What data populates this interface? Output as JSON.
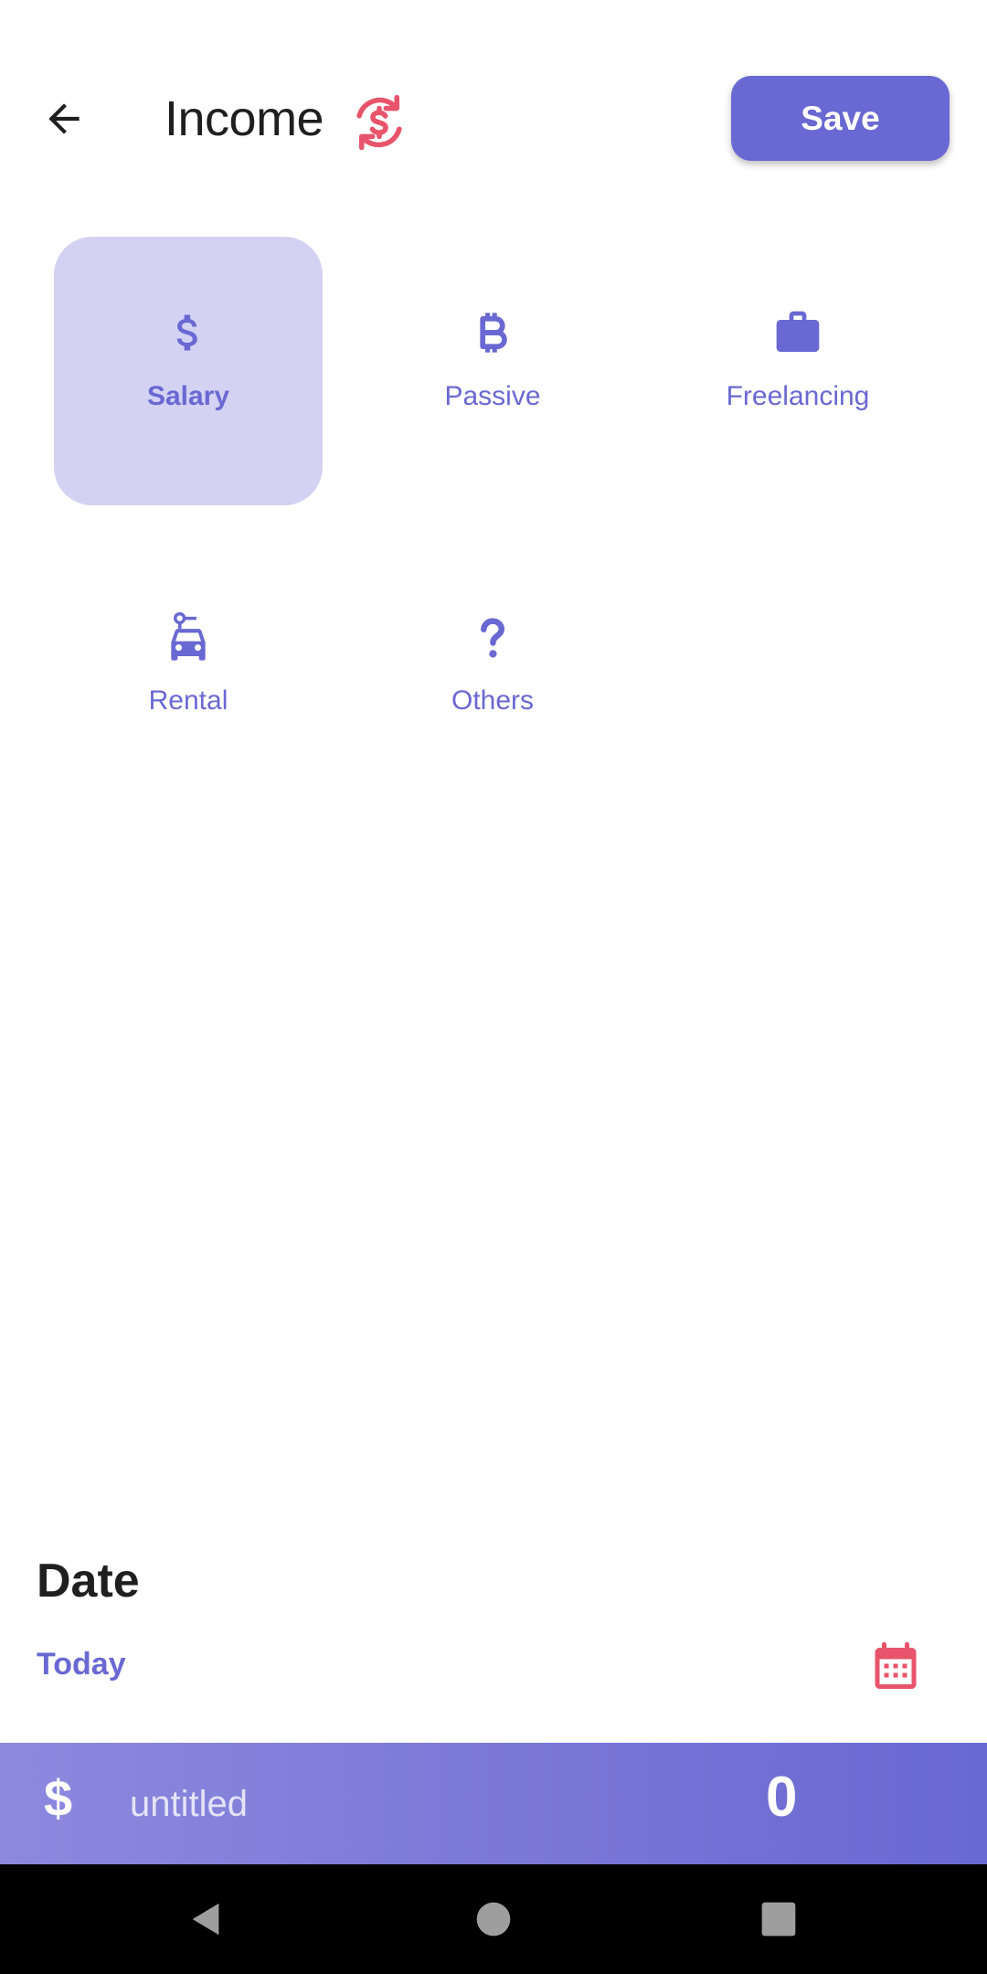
{
  "header": {
    "title": "Income",
    "save_label": "Save"
  },
  "categories": [
    {
      "label": "Salary",
      "icon": "dollar-icon",
      "selected": true
    },
    {
      "label": "Passive",
      "icon": "bitcoin-icon",
      "selected": false
    },
    {
      "label": "Freelancing",
      "icon": "briefcase-icon",
      "selected": false
    },
    {
      "label": "Rental",
      "icon": "car-rental-icon",
      "selected": false
    },
    {
      "label": "Others",
      "icon": "question-icon",
      "selected": false
    }
  ],
  "date": {
    "heading": "Date",
    "value": "Today"
  },
  "amount_bar": {
    "currency_symbol": "$",
    "title_placeholder": "untitled",
    "amount": "0"
  },
  "colors": {
    "accent": "#6a68d2",
    "accent_light": "#d3d2f3",
    "red_accent": "#e8546b"
  }
}
